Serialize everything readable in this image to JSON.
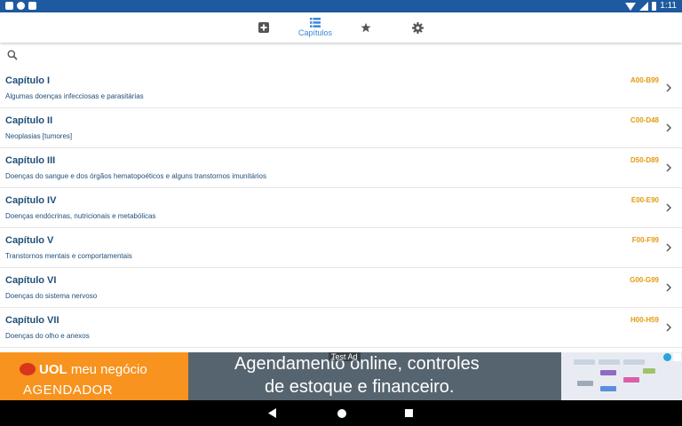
{
  "status_bar": {
    "time": "1:11",
    "left_icons": [
      "a-notification-icon",
      "circle-notification-icon",
      "file-notification-icon"
    ],
    "right_icons": [
      "wifi-icon",
      "signal-icon",
      "battery-icon"
    ]
  },
  "tabs": [
    {
      "id": "add",
      "icon": "plus-square-icon",
      "label": ""
    },
    {
      "id": "chapters",
      "icon": "list-icon",
      "label": "Capítulos",
      "active": true
    },
    {
      "id": "favorites",
      "icon": "star-icon",
      "label": ""
    },
    {
      "id": "settings",
      "icon": "gear-icon",
      "label": ""
    }
  ],
  "search": {
    "placeholder": "",
    "value": ""
  },
  "chapters": [
    {
      "title": "Capítulo I",
      "description": "Algumas doenças infecciosas e parasitárias",
      "code": "A00-B99"
    },
    {
      "title": "Capítulo II",
      "description": "Neoplasias [tumores]",
      "code": "C00-D48"
    },
    {
      "title": "Capítulo III",
      "description": "Doenças do sangue e dos órgãos hematopoéticos e alguns transtornos imunitários",
      "code": "D50-D89"
    },
    {
      "title": "Capítulo IV",
      "description": "Doenças endócrinas, nutricionais e metabólicas",
      "code": "E00-E90"
    },
    {
      "title": "Capítulo V",
      "description": "Transtornos mentais e comportamentais",
      "code": "F00-F99"
    },
    {
      "title": "Capítulo VI",
      "description": "Doenças do sistema nervoso",
      "code": "G00-G99"
    },
    {
      "title": "Capítulo VII",
      "description": "Doenças do olho e anexos",
      "code": "H00-H59"
    }
  ],
  "ad": {
    "test_label": "Test Ad",
    "brand_bold": "UOL",
    "brand_rest": " meu negócio",
    "brand_sub": "AGENDADOR",
    "line1": "Agendamento online, controles",
    "line2": "de estoque e financeiro."
  },
  "colors": {
    "status_bar": "#1e5aa0",
    "accent": "#3b86d8",
    "title_text": "#1f4e79",
    "code_text": "#e39a0c",
    "ad_orange": "#f7931e"
  }
}
